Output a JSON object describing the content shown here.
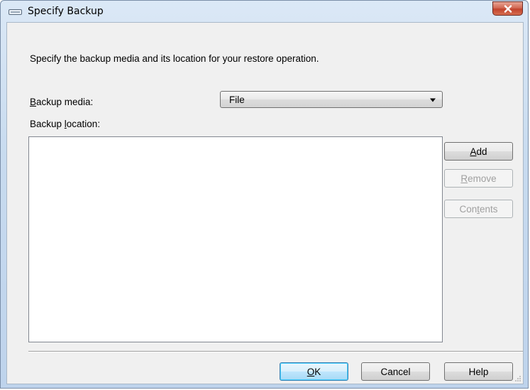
{
  "window": {
    "title": "Specify Backup",
    "title_icon": "tape-drive-icon",
    "close_icon": "close-icon"
  },
  "dialog": {
    "description": "Specify the backup media and its location for your restore operation.",
    "media": {
      "label_prefix": "",
      "label_access": "B",
      "label_rest": "ackup media:",
      "selected": "File"
    },
    "location": {
      "label_prefix": "Backup ",
      "label_access": "l",
      "label_rest": "ocation:",
      "items": []
    },
    "side_buttons": {
      "add": {
        "prefix": "",
        "access": "A",
        "rest": "dd",
        "enabled": true
      },
      "remove": {
        "prefix": "",
        "access": "R",
        "rest": "emove",
        "enabled": false
      },
      "contents": {
        "prefix": "Con",
        "access": "t",
        "rest": "ents",
        "enabled": false
      }
    },
    "footer_buttons": {
      "ok": {
        "prefix": "",
        "access": "O",
        "rest": "K"
      },
      "cancel": "Cancel",
      "help": "Help"
    }
  },
  "colors": {
    "title_gradient_top": "#dbe8f6",
    "close_button": "#c2432d",
    "dialog_background": "#f0f0f0",
    "default_button_border": "#3c7fb1"
  }
}
